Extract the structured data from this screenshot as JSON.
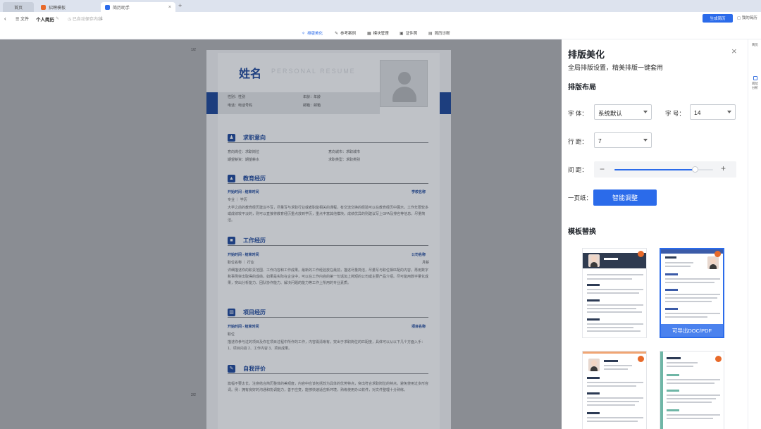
{
  "browser": {
    "tabs": [
      {
        "label": "首页"
      },
      {
        "label": "招聘模板"
      },
      {
        "label": "简历助手"
      }
    ]
  },
  "topbar": {
    "back": "‹",
    "file_menu": "文件",
    "doc_name": "个人简历",
    "autosave": "已自动保存内容",
    "generate_button": "生成简历",
    "my_resume": "我的简历"
  },
  "function_tabs": [
    {
      "label": "排版美化",
      "active": true
    },
    {
      "label": "参考案例",
      "active": false
    },
    {
      "label": "模块管理",
      "active": false
    },
    {
      "label": "证件照",
      "active": false
    },
    {
      "label": "简历诊断",
      "active": false
    }
  ],
  "canvas": {
    "page_indicator_1": "1/2",
    "page_indicator_2": "2/2"
  },
  "resume": {
    "name": "姓名",
    "name_en": "PERSONAL RESUME",
    "gender": "性别：性别",
    "age": "年龄：年龄",
    "phone": "电话：电话号码",
    "email": "邮箱：邮箱",
    "sections": {
      "intent": {
        "title": "求职意向",
        "job": "意向岗位：求职岗位",
        "city": "意向城市：求职城市",
        "salary": "期望薪资：期望薪水",
        "type": "求职类型：求职类别"
      },
      "education": {
        "title": "教育经历",
        "time": "开始时间 - 结束时间",
        "school": "学校名称",
        "major": "专业 ｜ 学历",
        "desc": "大学之前的教育经历建议不写，尽量写与求职行业或者职能相关的课程，有交流交换的经验可以在教育经历中展示。工作年限较多或成绩较平淡的，则可以直接将教育经历重点放到学历，重点丰富其他模块。成绩优异的则建议写上GPA及排名等信息，尽量简洁。"
      },
      "work": {
        "title": "工作经历",
        "time": "开始时间 - 结束时间",
        "company": "公司名称",
        "position": "职位名称 ｜ 行业",
        "dept": "月薪",
        "desc": "详细描述你的职责范围、工作内容和工作成果。最新的工作经验放在最前，描述尽量简洁，尽量写与职位相匹配的内容。再用数字和事例突出取得的成绩，如果是实际在企业中，可以在工作内容的第一句话加上简短的公司或主要产品介绍。尽可能用数字量化成果，突出分析能力、团队协作能力、解决问题的能力等工作上所用的专业素质。"
      },
      "project": {
        "title": "项目经历",
        "time": "开始时间 - 结束时间",
        "name": "项目名称",
        "role": "职位",
        "desc": "描述你参与过的项目及你在项目过程中所作的工作，内容需清晰有，突出于求职岗位的匹配度，具体可以从以下几个方面入手：1、项目内容 2、工作内容 3、项目成果。"
      },
      "evaluation": {
        "title": "自我评价",
        "desc": "篇幅不要太长，注意结合简历整体的美观度，内容中应该包括较为具体的优势特点，突出符合求职岗位的特点。避免使用过多形容词。例：拥有良好的沟通和协调能力，善于应变，能够快速适应新环境，熟练使用办公软件，对文件整理十分熟练。"
      }
    }
  },
  "panel": {
    "title": "排版美化",
    "close": "×",
    "subtitle": "全局排版设置，精美排版一键套用",
    "layout_heading": "排版布局",
    "font_label": "字 体：",
    "font_value": "系统默认",
    "size_label": "字 号：",
    "size_value": "14",
    "line_label": "行 距：",
    "line_value": "7",
    "spacing_label": "间 距：",
    "spacing_level": 0.82,
    "onepage_label": "一页纸：",
    "smart_button": "智能调整",
    "template_heading": "模板替换",
    "template_export": "可导出DOC/PDF"
  },
  "rail": {
    "items": [
      {
        "label": "简历"
      },
      {
        "label": "岗位\n分析"
      }
    ]
  },
  "colors": {
    "accent": "#2b6bea",
    "resume_navy": "#1e3f80",
    "canvas_overlay": "#8a8d93"
  }
}
